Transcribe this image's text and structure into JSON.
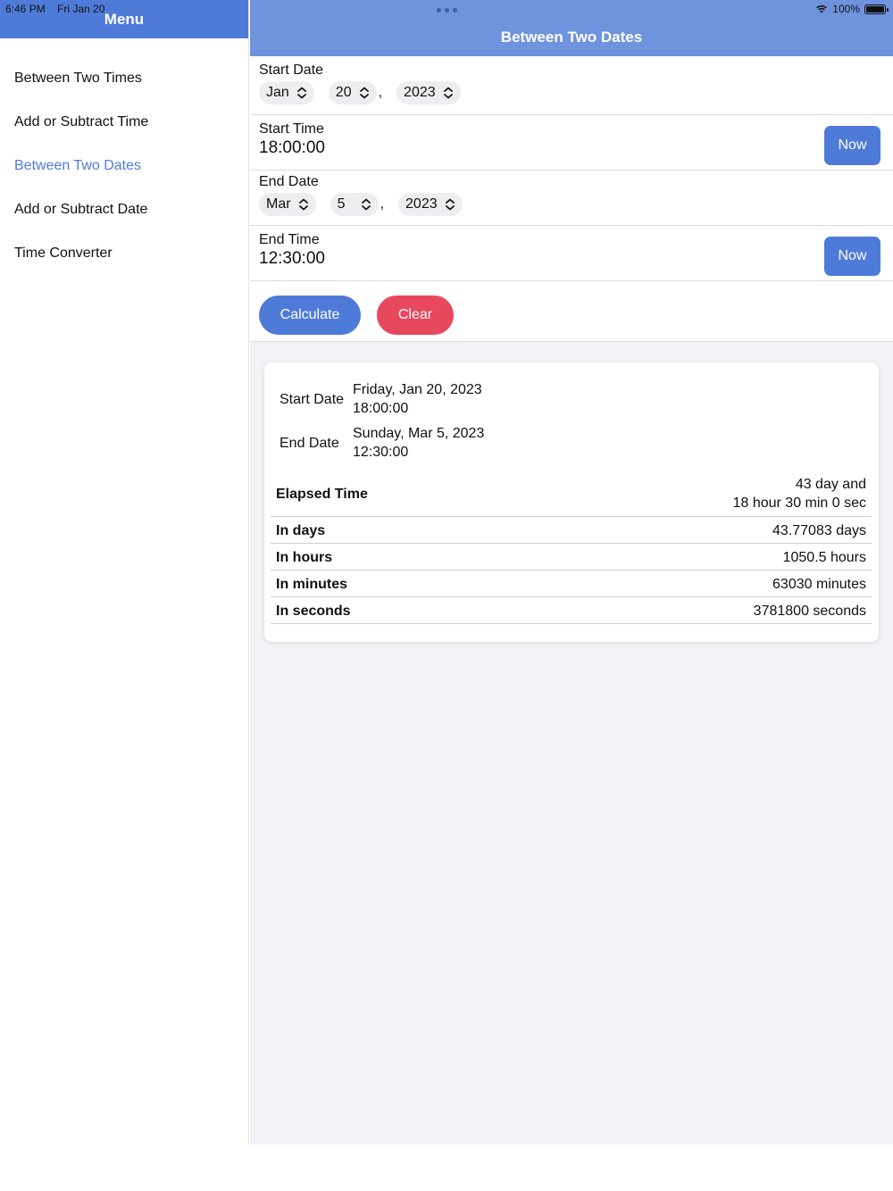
{
  "status": {
    "time": "6:46 PM",
    "date": "Fri Jan 20",
    "battery": "100%"
  },
  "sidebar": {
    "title": "Menu",
    "items": [
      {
        "label": "Between Two Times"
      },
      {
        "label": "Add or Subtract Time"
      },
      {
        "label": "Between Two Dates"
      },
      {
        "label": "Add or Subtract Date"
      },
      {
        "label": "Time Converter"
      }
    ],
    "active_item": "Between Two Dates"
  },
  "header": {
    "title": "Between Two Dates"
  },
  "form": {
    "start_date": {
      "label": "Start Date",
      "month": "Jan",
      "day": "20",
      "year": "2023"
    },
    "start_time": {
      "label": "Start Time",
      "value": "18:00:00",
      "now_label": "Now"
    },
    "end_date": {
      "label": "End Date",
      "month": "Mar",
      "day": "5",
      "year": "2023"
    },
    "end_time": {
      "label": "End Time",
      "value": "12:30:00",
      "now_label": "Now"
    },
    "comma": ",",
    "calculate_label": "Calculate",
    "clear_label": "Clear"
  },
  "result": {
    "start_label": "Start Date",
    "start_value_line1": "Friday, Jan 20, 2023",
    "start_value_line2": "18:00:00",
    "end_label": "End Date",
    "end_value_line1": "Sunday, Mar 5, 2023",
    "end_value_line2": "12:30:00",
    "rows": [
      {
        "label": "Elapsed Time",
        "line1": "43 day and",
        "line2": "18 hour 30 min 0 sec"
      },
      {
        "label": "In days",
        "value": "43.77083 days"
      },
      {
        "label": "In hours",
        "value": "1050.5 hours"
      },
      {
        "label": "In minutes",
        "value": "63030 minutes"
      },
      {
        "label": "In seconds",
        "value": "3781800 seconds"
      }
    ]
  },
  "colors": {
    "accent": "#4f7bd8",
    "nav": "#6f93dc",
    "danger": "#e8485d",
    "background": "#f2f3f7"
  },
  "icons": {
    "picker": "chevron-up-down-icon",
    "wifi": "wifi-icon",
    "battery": "battery-icon",
    "multitask": "multitasking-dots-icon"
  }
}
